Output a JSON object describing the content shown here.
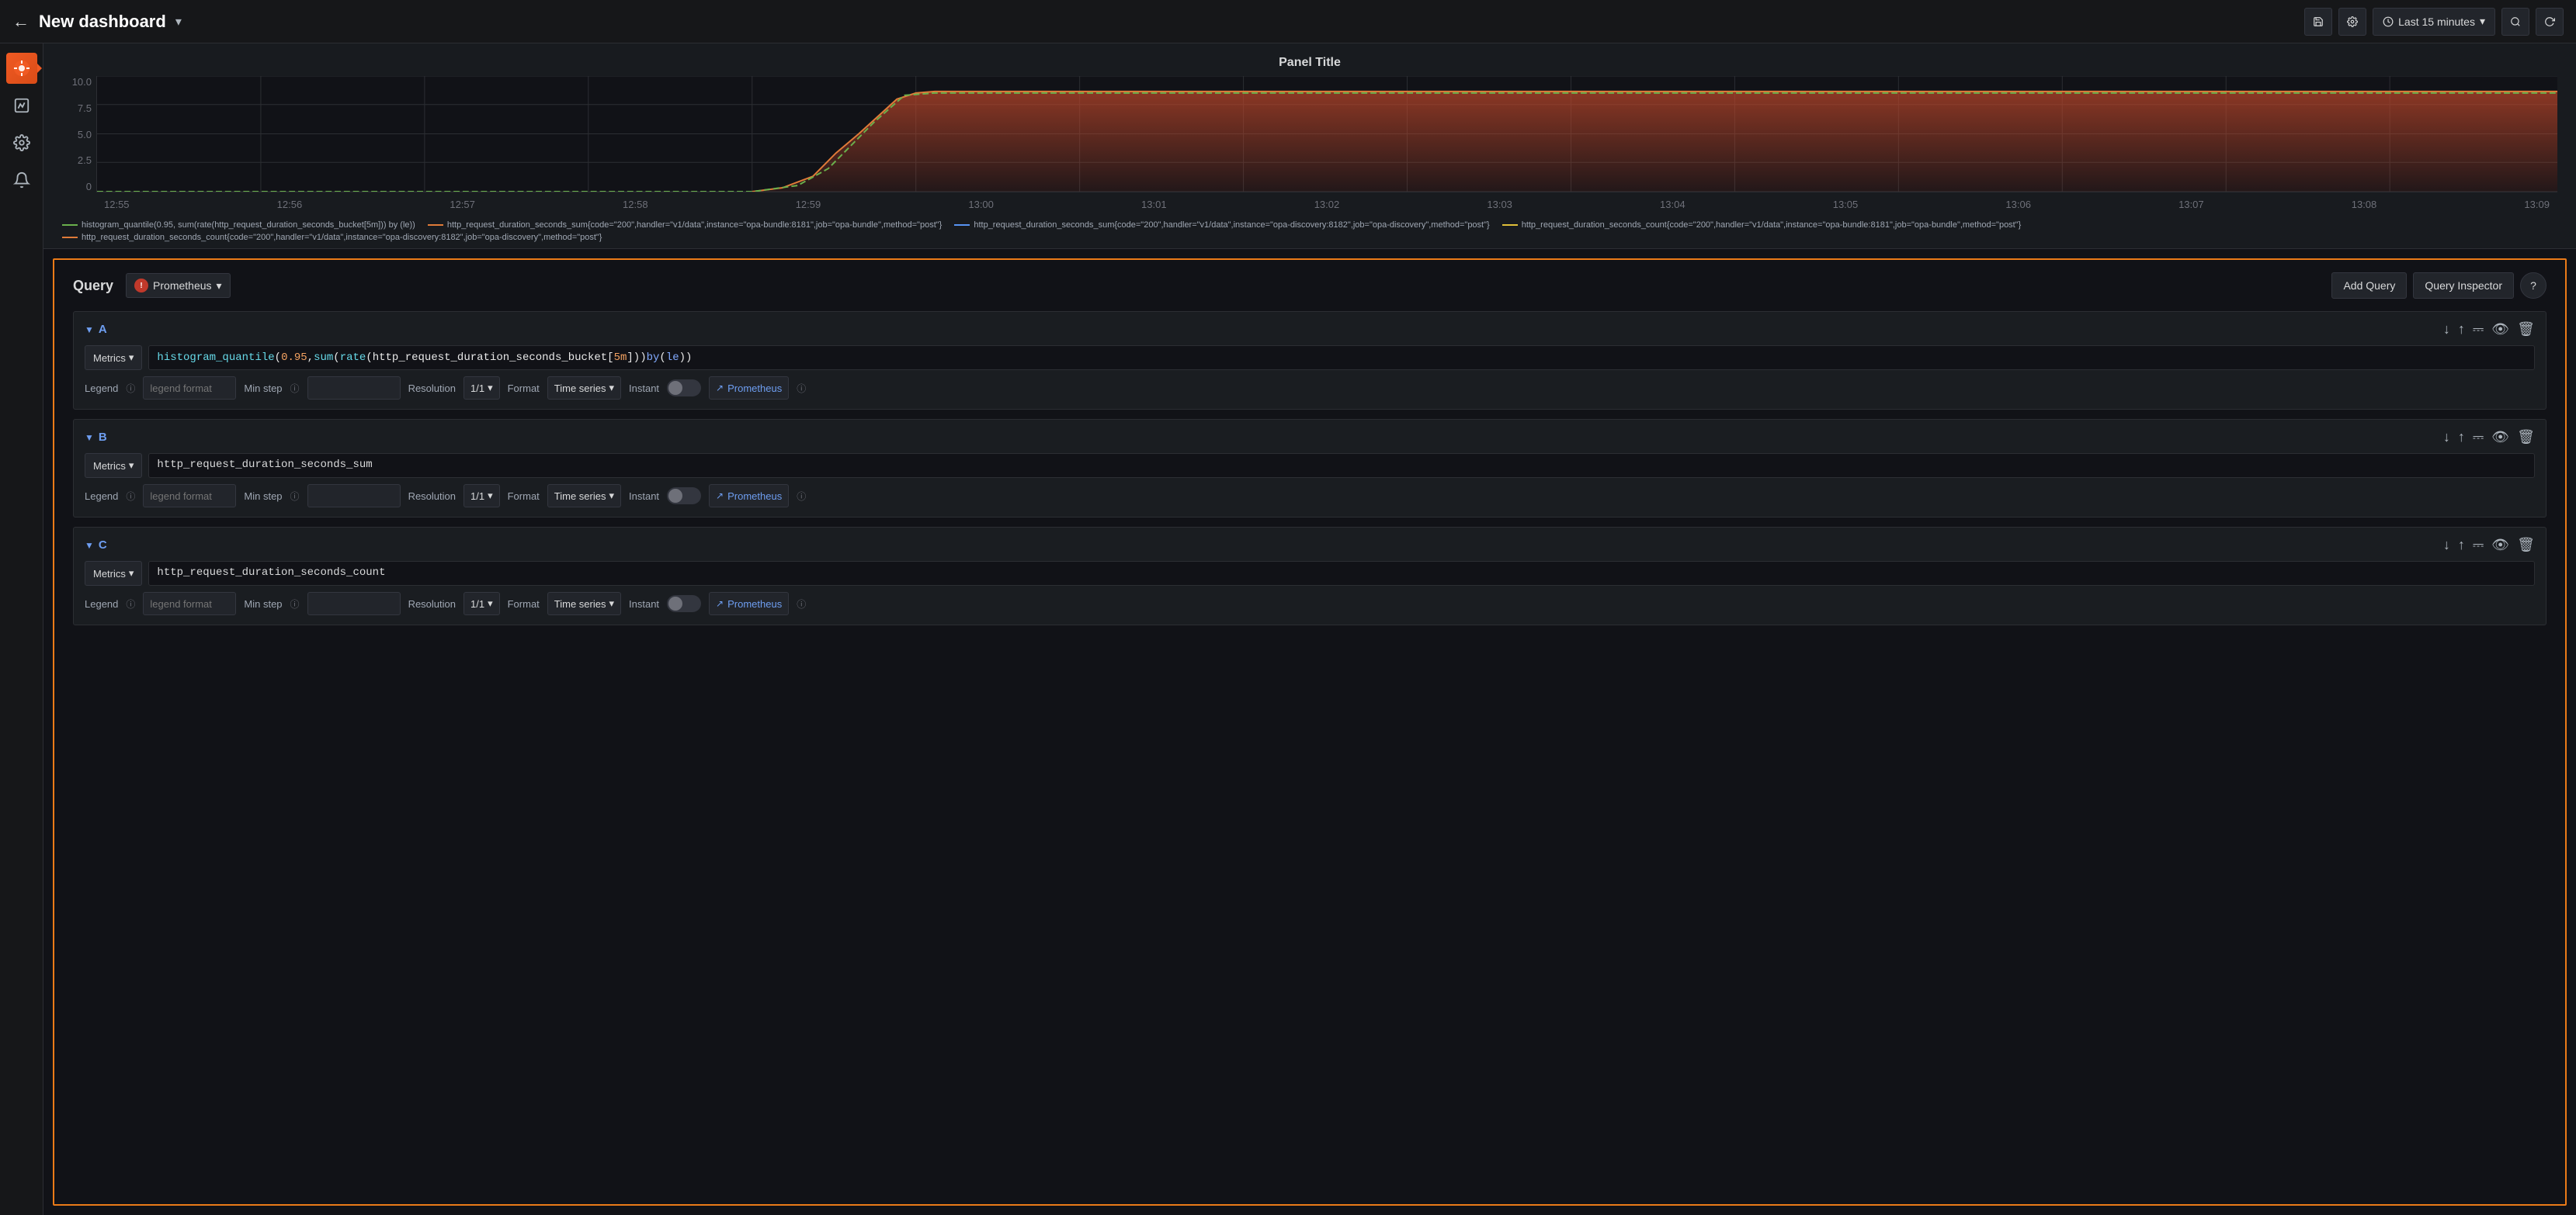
{
  "header": {
    "back_icon": "←",
    "title": "New dashboard",
    "chevron": "▾",
    "nav_buttons": [
      {
        "name": "save-icon",
        "label": "💾"
      },
      {
        "name": "settings-icon",
        "label": "⚙"
      },
      {
        "name": "time-range",
        "label": "Last 15 minutes",
        "chevron": "▾"
      },
      {
        "name": "search-icon",
        "label": "🔍"
      },
      {
        "name": "refresh-icon",
        "label": "↻"
      }
    ]
  },
  "sidebar": {
    "items": [
      {
        "name": "grafana-logo",
        "active": true,
        "label": "🔶"
      },
      {
        "name": "chart-icon",
        "active": false,
        "label": "📊"
      },
      {
        "name": "settings-icon",
        "active": false,
        "label": "⚙"
      },
      {
        "name": "bell-icon",
        "active": false,
        "label": "🔔"
      }
    ]
  },
  "chart": {
    "title": "Panel Title",
    "y_axis": [
      "10.0",
      "7.5",
      "5.0",
      "2.5",
      "0"
    ],
    "x_axis": [
      "12:55",
      "12:56",
      "12:57",
      "12:58",
      "12:59",
      "13:00",
      "13:01",
      "13:02",
      "13:03",
      "13:04",
      "13:05",
      "13:06",
      "13:07",
      "13:08",
      "13:09"
    ],
    "legend": [
      {
        "color": "#6ab04c",
        "style": "dashed",
        "text": "histogram_quantile(0.95, sum(rate(http_request_duration_seconds_bucket[5m])) by (le))"
      },
      {
        "color": "#e07b39",
        "style": "solid",
        "text": "http_request_duration_seconds_sum{code=\"200\",handler=\"v1/data\",instance=\"opa-bundle:8181\",job=\"opa-bundle\",method=\"post\"}"
      },
      {
        "color": "#5794f2",
        "style": "solid",
        "text": "http_request_duration_seconds_sum{code=\"200\",handler=\"v1/data\",instance=\"opa-discovery:8182\",job=\"opa-discovery\",method=\"post\"}"
      },
      {
        "color": "#e0c039",
        "style": "dashed",
        "text": "http_request_duration_seconds_count{code=\"200\",handler=\"v1/data\",instance=\"opa-bundle:8181\",job=\"opa-bundle\",method=\"post\"}"
      },
      {
        "color": "#e07b39",
        "style": "solid",
        "text": "http_request_duration_seconds_count{code=\"200\",handler=\"v1/data\",instance=\"opa-discovery:8182\",job=\"opa-discovery\",method=\"post\"}"
      }
    ]
  },
  "query_panel": {
    "label": "Query",
    "datasource": "Prometheus",
    "add_query_label": "Add Query",
    "query_inspector_label": "Query Inspector",
    "help_label": "?",
    "queries": [
      {
        "id": "A",
        "metrics_label": "Metrics",
        "expression": "histogram_quantile(0.95, sum(rate(http_request_duration_seconds_bucket[5m])) by (le))",
        "legend_label": "Legend",
        "legend_placeholder": "legend format",
        "min_step_label": "Min step",
        "min_step_placeholder": "",
        "resolution_label": "Resolution",
        "resolution_value": "1/1",
        "format_label": "Format",
        "format_value": "Time series",
        "instant_label": "Instant",
        "prometheus_label": "Prometheus"
      },
      {
        "id": "B",
        "metrics_label": "Metrics",
        "expression": "http_request_duration_seconds_sum",
        "legend_label": "Legend",
        "legend_placeholder": "legend format",
        "min_step_label": "Min step",
        "min_step_placeholder": "",
        "resolution_label": "Resolution",
        "resolution_value": "1/1",
        "format_label": "Format",
        "format_value": "Time series",
        "instant_label": "Instant",
        "prometheus_label": "Prometheus"
      },
      {
        "id": "C",
        "metrics_label": "Metrics",
        "expression": "http_request_duration_seconds_count",
        "legend_label": "Legend",
        "legend_placeholder": "legend format",
        "min_step_label": "Min step",
        "min_step_placeholder": "",
        "resolution_label": "Resolution",
        "resolution_value": "1/1",
        "format_label": "Format",
        "format_value": "Time series",
        "instant_label": "Instant",
        "prometheus_label": "Prometheus"
      }
    ]
  }
}
